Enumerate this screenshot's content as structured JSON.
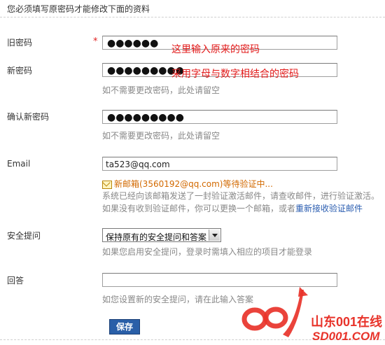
{
  "notice": "您必须填写原密码才能修改下面的资料",
  "fields": {
    "old_password": {
      "label": "旧密码",
      "required_mark": "*",
      "value_masked": "●●●●●●",
      "annotation": "这里输入原来的密码"
    },
    "new_password": {
      "label": "新密码",
      "value_masked": "●●●●●●●●●",
      "annotation": "采用字母与数字相结合的密码",
      "hint": "如不需要更改密码，此处请留空"
    },
    "confirm_password": {
      "label": "确认新密码",
      "value_masked": "●●●●●●●●●",
      "hint": "如不需要更改密码，此处请留空"
    },
    "email": {
      "label": "Email",
      "value": "ta523@qq.com",
      "pending_notice": "新邮箱(3560192@qq.com)等待验证中...",
      "info_line1": "系统已经向该邮箱发送了一封验证激活邮件，请查收邮件，进行验证激活。",
      "info_line2_prefix": "如果没有收到验证邮件，你可以更换一个邮箱，或者",
      "info_line2_link": "重新接收验证邮件"
    },
    "security_question": {
      "label": "安全提问",
      "selected": "保持原有的安全提问和答案",
      "hint": "如果您启用安全提问，登录时需填入相应的项目才能登录"
    },
    "answer": {
      "label": "回答",
      "value": "",
      "hint": "如您设置新的安全提问，请在此输入答案"
    }
  },
  "save_label": "保存",
  "watermark": {
    "brand": "山东001在线",
    "domain": "SD001.COM"
  }
}
